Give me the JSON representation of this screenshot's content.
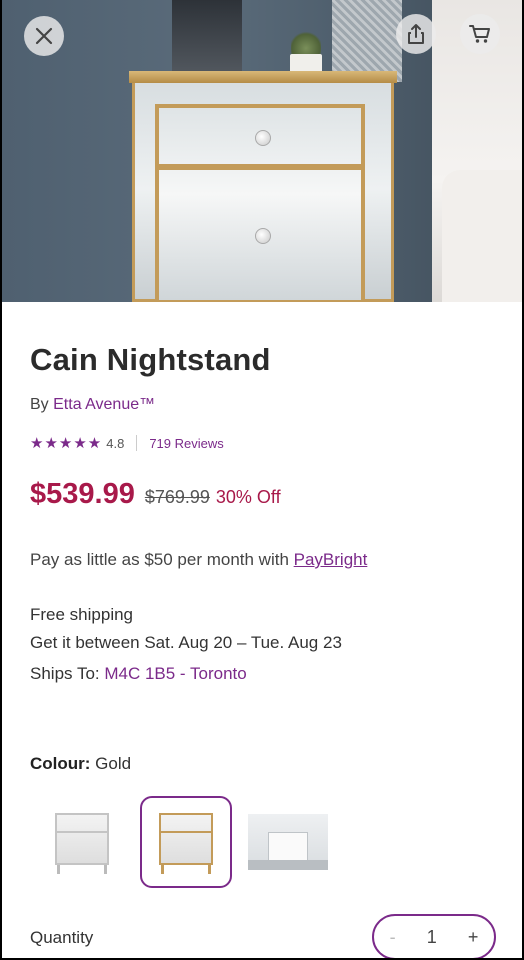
{
  "product": {
    "title": "Cain Nightstand",
    "by_prefix": "By ",
    "brand": "Etta Avenue™",
    "stars": "★★★★★",
    "rating": "4.8",
    "reviews": "719 Reviews",
    "price": "$539.99",
    "old_price": "$769.99",
    "discount": "30% Off"
  },
  "financing": {
    "text": "Pay as little as $50 per month with ",
    "link": "PayBright"
  },
  "shipping": {
    "line1": "Free shipping",
    "line2": "Get it between Sat. Aug 20 – Tue. Aug 23",
    "ships_to_label": "Ships To: ",
    "ships_to_value": "M4C 1B5 - Toronto"
  },
  "colour": {
    "label": "Colour:",
    "value": "Gold"
  },
  "quantity": {
    "label": "Quantity",
    "minus": "-",
    "value": "1",
    "plus": "+"
  },
  "icons": {
    "close": "close-icon",
    "share": "share-icon",
    "cart": "cart-icon"
  },
  "colors": {
    "accent": "#7b2a8a",
    "price": "#a8194a"
  }
}
